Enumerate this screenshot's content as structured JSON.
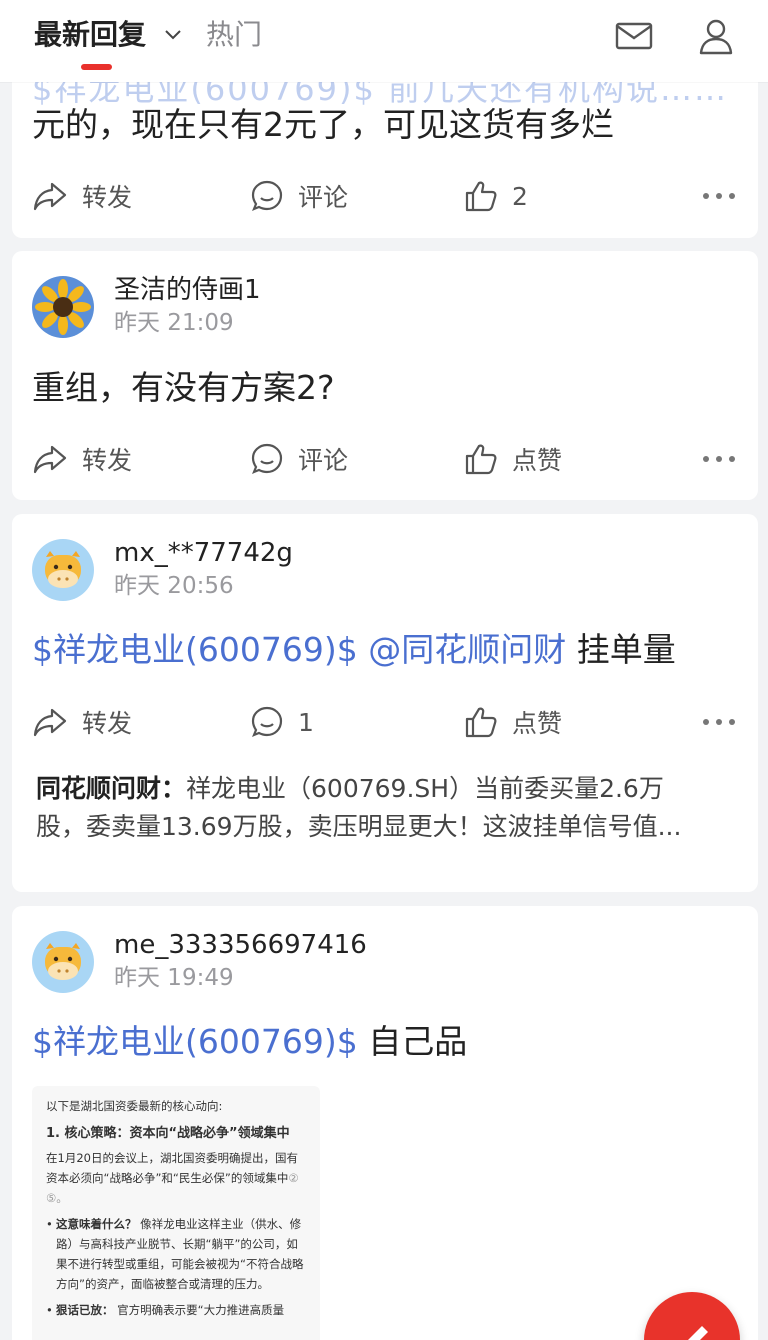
{
  "top_nav": {
    "tab_latest": "最新回复",
    "tab_hot": "热门",
    "accent_color": "#e9312c"
  },
  "posts": [
    {
      "partial_top": "$祥龙电业(600769)$ 前几天还有机构说……",
      "text": "元的，现在只有2元了，可见这货有多烂",
      "forward_label": "转发",
      "comment_label": "评论",
      "like_count": "2"
    },
    {
      "username": "圣洁的侍画1",
      "time": "昨天 21:09",
      "avatar_icon": "sunflower-icon",
      "text": "重组，有没有方案2?",
      "forward_label": "转发",
      "comment_label": "评论",
      "like_label": "点赞"
    },
    {
      "username": "mx_**77742g",
      "time": "昨天 20:56",
      "avatar_icon": "cow-icon",
      "stock_link": "$祥龙电业(600769)$",
      "mention": "@同花顺问财",
      "text_tail": "挂单量",
      "forward_label": "转发",
      "comment_count": "1",
      "like_label": "点赞",
      "reply_author": "同花顺问财：",
      "reply_line1": "祥龙电业（600769.SH）当前委买量2.6万",
      "reply_line2": "股，委卖量13.69万股，卖压明显更大！这波挂单信号值..."
    },
    {
      "username": "me_333356697416",
      "time": "昨天 19:49",
      "avatar_icon": "cow-icon",
      "stock_link": "$祥龙电业(600769)$",
      "text_tail": "自己品",
      "image": {
        "intro": "以下是湖北国资委最新的核心动向:",
        "heading": "1. 核心策略：资本向“战略必争”领域集中",
        "para1": "在1月20日的会议上，湖北国资委明确提出，国有资本必须向“战略必争”和“民生必保”的领域集中",
        "para1_refs": "② ⑤。",
        "bullet1_title": "这意味着什么？",
        "bullet1_text": "像祥龙电业这样主业（供水、修路）与高科技产业脱节、长期“躺平”的公司，如果不进行转型或重组，可能会被视为“不符合战略方向”的资产，面临被整合或清理的压力。",
        "bullet2_title": "狠话已放：",
        "bullet2_text": "官方明确表示要“大力推进高质量"
      }
    }
  ]
}
